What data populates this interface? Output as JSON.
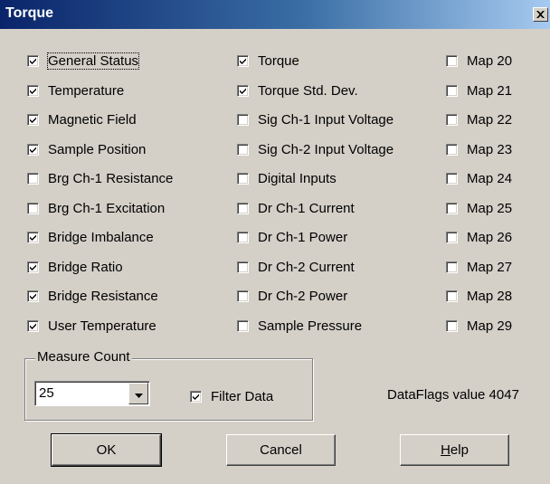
{
  "window": {
    "title": "Torque"
  },
  "columns": [
    [
      {
        "label": "General Status",
        "checked": true
      },
      {
        "label": "Temperature",
        "checked": true
      },
      {
        "label": "Magnetic Field",
        "checked": true
      },
      {
        "label": "Sample Position",
        "checked": true
      },
      {
        "label": "Brg Ch-1 Resistance",
        "checked": false
      },
      {
        "label": "Brg Ch-1 Excitation",
        "checked": false
      },
      {
        "label": "Bridge Imbalance",
        "checked": true
      },
      {
        "label": "Bridge Ratio",
        "checked": true
      },
      {
        "label": "Bridge Resistance",
        "checked": true
      },
      {
        "label": "User Temperature",
        "checked": true
      }
    ],
    [
      {
        "label": "Torque",
        "checked": true
      },
      {
        "label": "Torque Std. Dev.",
        "checked": true
      },
      {
        "label": "Sig Ch-1 Input Voltage",
        "checked": false
      },
      {
        "label": "Sig Ch-2 Input Voltage",
        "checked": false
      },
      {
        "label": "Digital Inputs",
        "checked": false
      },
      {
        "label": "Dr Ch-1 Current",
        "checked": false
      },
      {
        "label": "Dr Ch-1 Power",
        "checked": false
      },
      {
        "label": "Dr Ch-2 Current",
        "checked": false
      },
      {
        "label": "Dr Ch-2 Power",
        "checked": false
      },
      {
        "label": "Sample Pressure",
        "checked": false
      }
    ],
    [
      {
        "label": "Map 20",
        "checked": false
      },
      {
        "label": "Map 21",
        "checked": false
      },
      {
        "label": "Map 22",
        "checked": false
      },
      {
        "label": "Map 23",
        "checked": false
      },
      {
        "label": "Map 24",
        "checked": false
      },
      {
        "label": "Map 25",
        "checked": false
      },
      {
        "label": "Map 26",
        "checked": false
      },
      {
        "label": "Map 27",
        "checked": false
      },
      {
        "label": "Map 28",
        "checked": false
      },
      {
        "label": "Map 29",
        "checked": false
      }
    ]
  ],
  "measure": {
    "group_label": "Measure Count",
    "count_value": "25",
    "filter_label": "Filter Data",
    "filter_checked": true
  },
  "dataflags_text": "DataFlags value 4047",
  "buttons": {
    "ok": "OK",
    "cancel": "Cancel",
    "help_mnemonic": "H",
    "help_rest": "elp"
  },
  "icons": {
    "close": "close-icon",
    "dropdown": "chevron-down-icon",
    "check": "check-icon"
  },
  "colors": {
    "titlebar_start": "#0a246a",
    "titlebar_end": "#a6caf0",
    "face": "#d4d0c8"
  }
}
